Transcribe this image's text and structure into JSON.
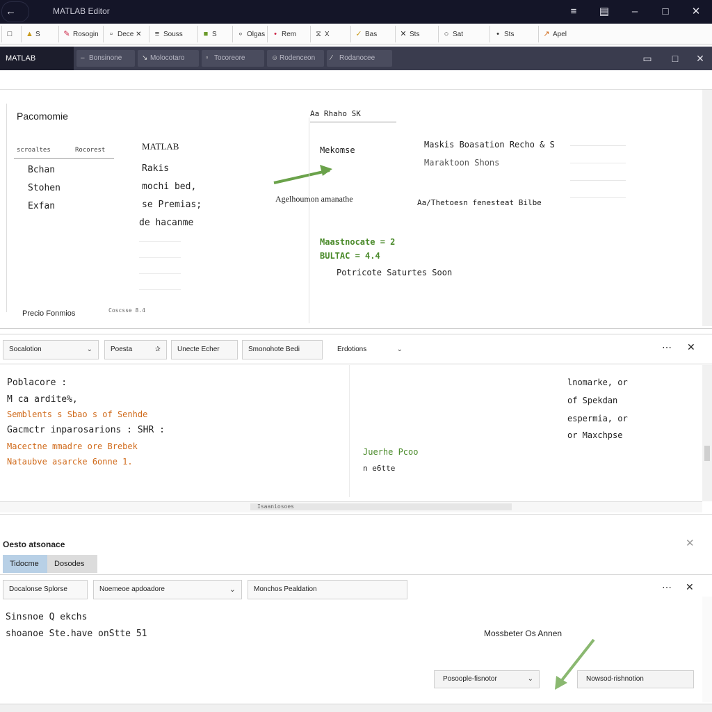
{
  "window": {
    "title": "MATLAB Editor"
  },
  "file_tabs": [
    {
      "label": "S",
      "icon": "folder-icon"
    },
    {
      "label": "Rosogin",
      "icon": "brush-icon"
    },
    {
      "label": "Dece",
      "icon": "close-icon"
    },
    {
      "label": "Souss",
      "icon": "stack-icon"
    },
    {
      "label": "S",
      "icon": "grid-icon"
    },
    {
      "label": "Olgas",
      "icon": "link-icon"
    },
    {
      "label": "Rem",
      "icon": "pin-icon"
    },
    {
      "label": "X",
      "icon": "hourglass-icon"
    },
    {
      "label": "Bas",
      "icon": "check-icon"
    },
    {
      "label": "Sts",
      "icon": "x-icon"
    },
    {
      "label": "Sat",
      "icon": "circle-icon"
    },
    {
      "label": "Sts",
      "icon": "pin-icon"
    },
    {
      "label": "Apel",
      "icon": "arrow-icon"
    }
  ],
  "toolbar": {
    "brand": "MATLAB",
    "tabs": [
      "Bonsinone",
      "Molocotaro",
      "Tocoreore",
      "Rodenceon",
      "Rodanocee"
    ]
  },
  "editor": {
    "left": {
      "heading": "Pacomomie",
      "subheads": [
        "scroaltes",
        "Rocorest"
      ],
      "items": [
        "Bchan",
        "Stohen",
        "Exfan"
      ],
      "footer": "Precio Fonmios",
      "footer2": "Coscsse 8.4"
    },
    "middle": {
      "heading": "MATLAB",
      "lines": [
        "Rakis",
        "mochi bed,",
        "se Premias;",
        "de hacanme"
      ],
      "caption": "Agelhoumon amanathe"
    },
    "right": {
      "heading": "Aa Rhaho SK",
      "sub": "Mekomse",
      "code": [
        "Maskis Boasation Recho & S",
        "Maraktoon Shons"
      ],
      "line2": "Aa/Thetoesn fenesteat Bilbe",
      "green1": "Maastnocate = 2",
      "green2": "BULTAC = 4.4",
      "line3": "Potricote  Saturtes Soon"
    }
  },
  "panel2": {
    "tools": [
      {
        "label": "Socalotion",
        "type": "dropdown"
      },
      {
        "label": "Poesta",
        "type": "button"
      },
      {
        "label": "Unecte Echer",
        "type": "button"
      },
      {
        "label": "Smonohote Bedi",
        "type": "button"
      },
      {
        "label": "Erdotions",
        "type": "dropdown"
      }
    ],
    "lines": [
      "Poblacore :",
      "M ca ardite%,",
      "Semblents s Sbao s of Senhde",
      "Gacmctr inparosarions : SHR :",
      "Macectne mmadre ore Brebek",
      "Nataubve asarcke 6onne 1."
    ],
    "mid_label": "Juerhe Pcoo",
    "mid_label2": "n e6tte",
    "right_lines": [
      "lnomarke, or",
      "of Spekdan",
      "espermia, or",
      "or Maxchpse"
    ],
    "hscroll_label": "Isaaniosoes"
  },
  "panel3": {
    "title": "Oesto atsonace",
    "tabs": [
      "Tidocme",
      "Dosodes"
    ],
    "fields": [
      {
        "label": "Docalonse Splorse"
      },
      {
        "label": "Noemeoe apdoadore"
      },
      {
        "label": "Monchos Pealdation"
      }
    ],
    "lines": [
      "Sinsnoe Q ekchs",
      "shoanoe Ste.have onStte 51"
    ],
    "note": "Mossbeter Os Annen",
    "buttons": [
      "Posoople-fisnotor",
      "Nowsod-rishnotion"
    ]
  },
  "colors": {
    "titlebar": "#141528",
    "subbar": "#3a3c4e",
    "accent_green": "#4a8a2a",
    "accent_orange": "#d06a1a"
  }
}
